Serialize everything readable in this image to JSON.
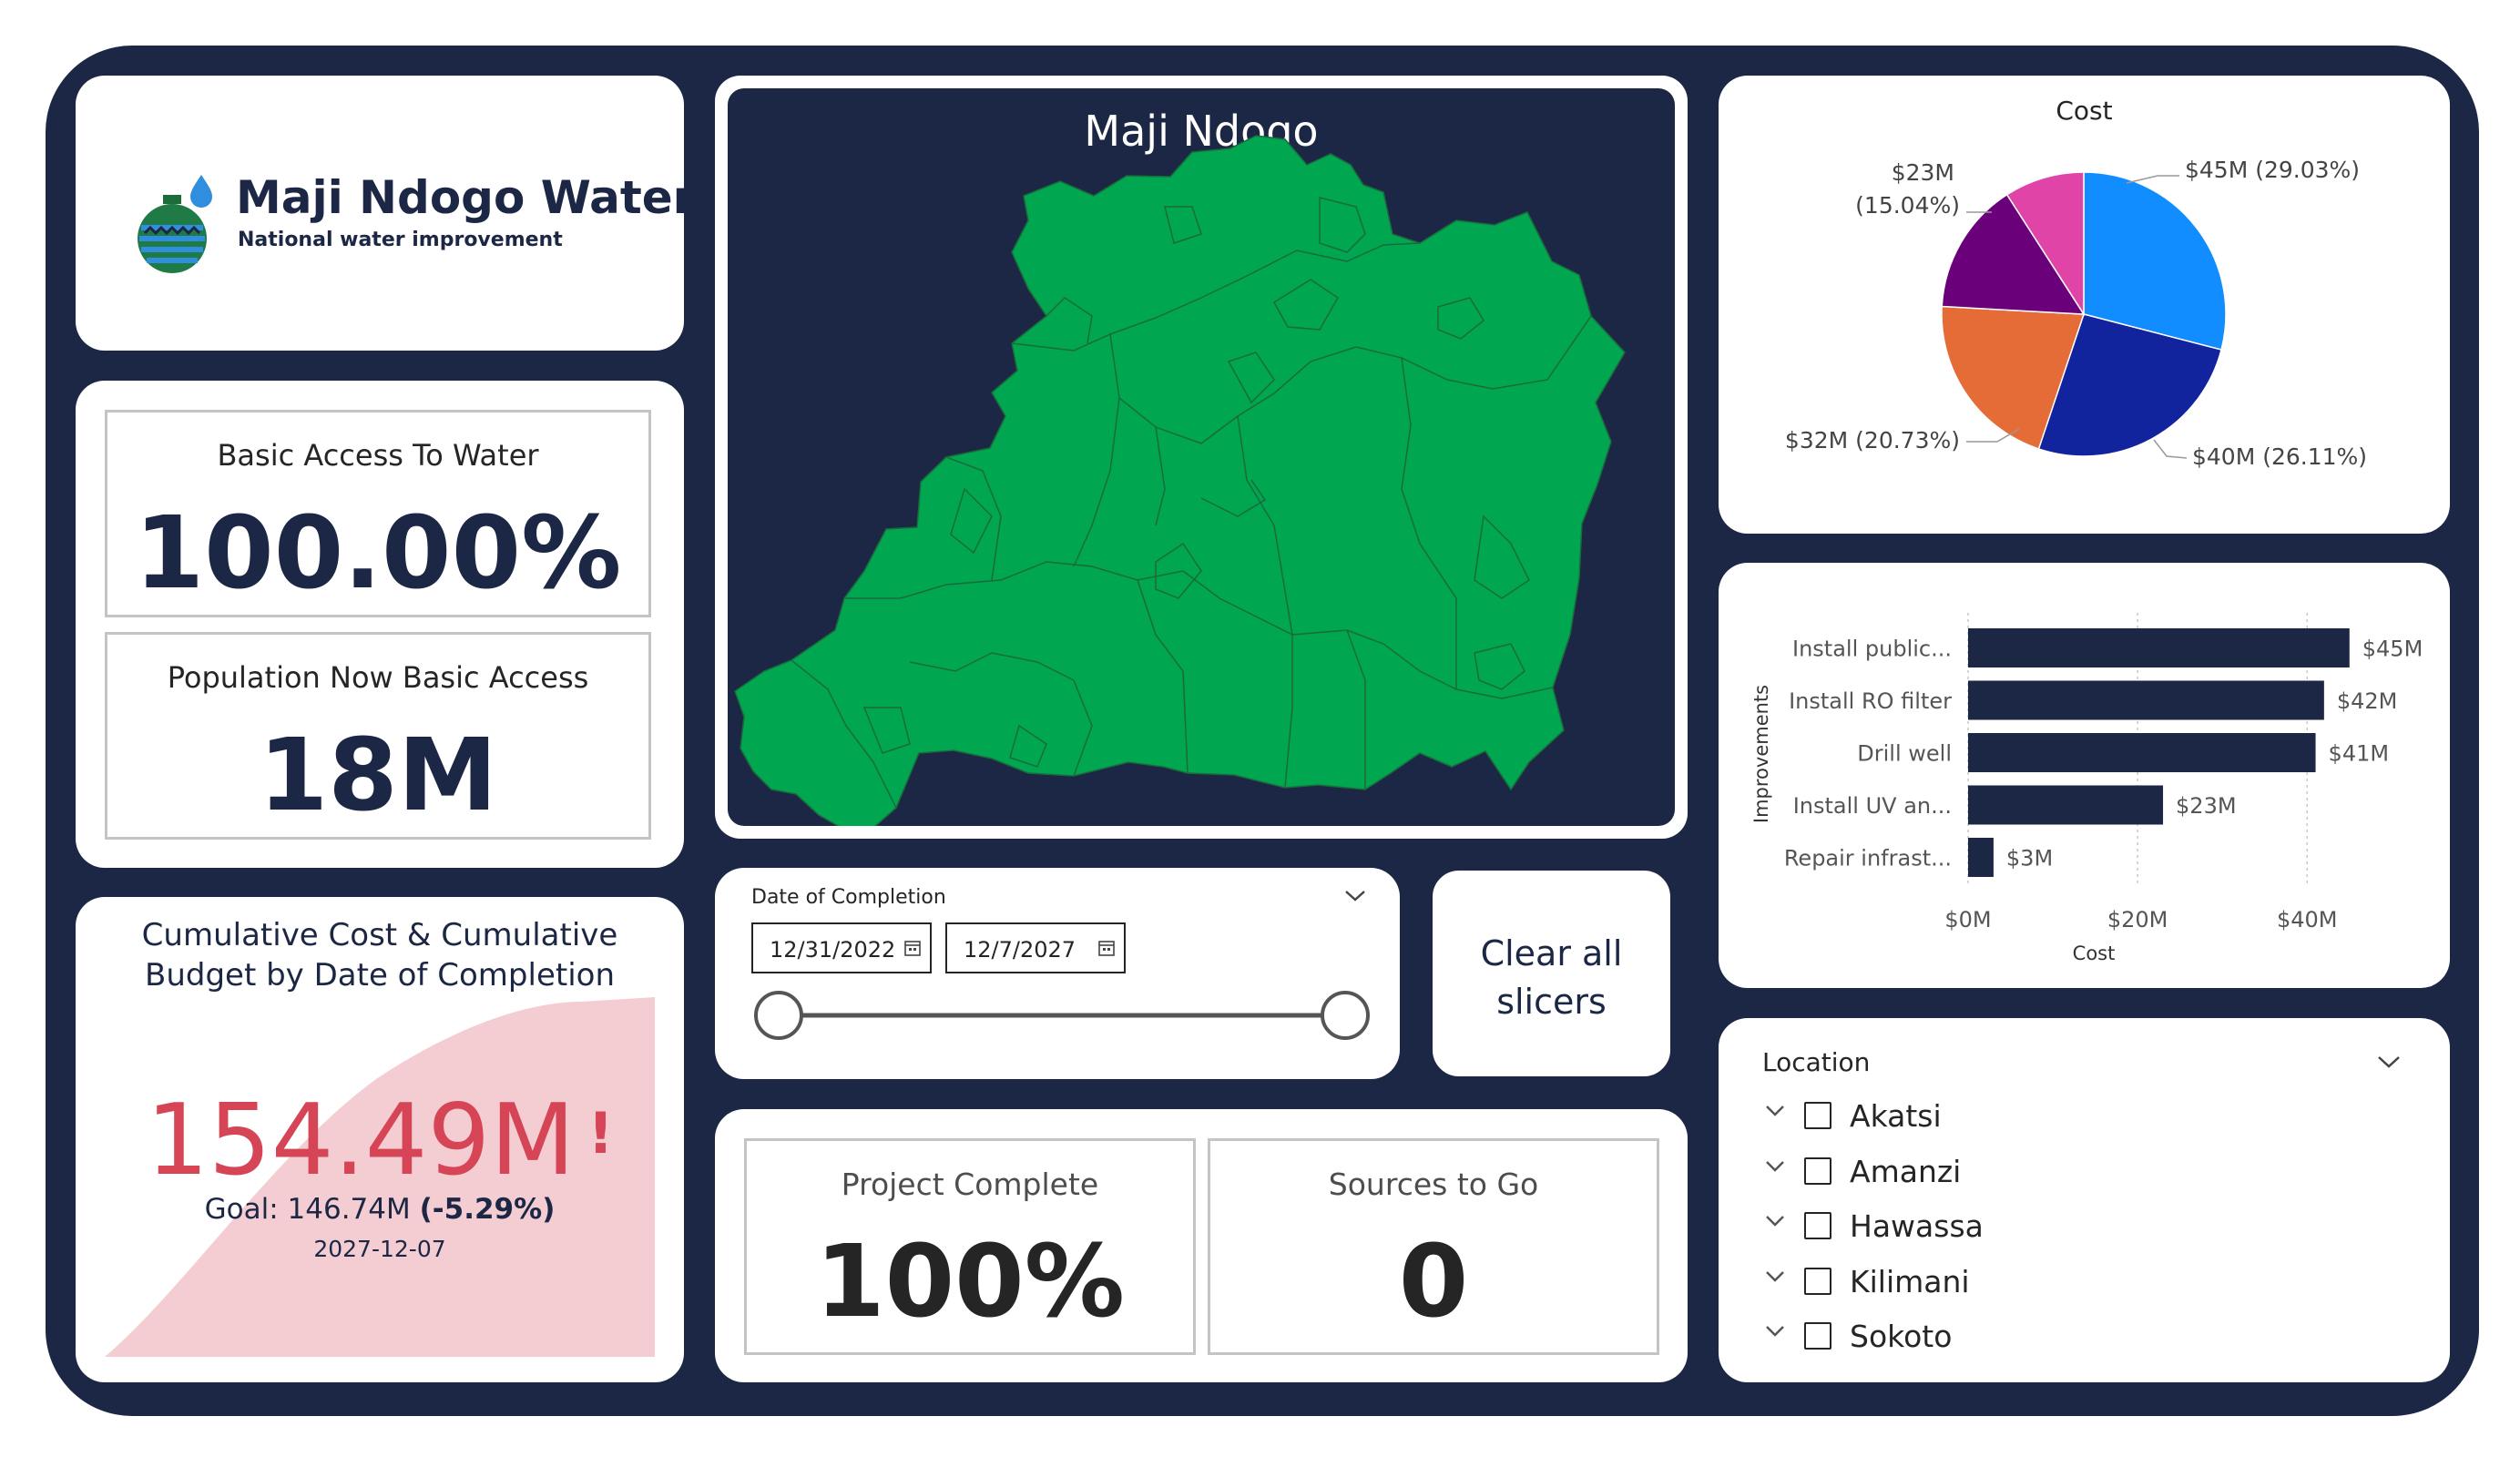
{
  "logo": {
    "title": "Maji Ndogo Water",
    "subtitle": "National water improvement",
    "icon": "water-pot-droplet-icon"
  },
  "kpis": {
    "basic_access_label": "Basic Access To Water",
    "basic_access_value": "100.00%",
    "population_label": "Population Now Basic Access",
    "population_value": "18M"
  },
  "cumulative": {
    "title": "Cumulative Cost & Cumulative Budget by Date of Completion",
    "value": "154.49M",
    "alert": "!",
    "goal_prefix": "Goal: 146.74M ",
    "goal_pct": "(-5.29%)",
    "date": "2027-12-07",
    "area_color": "#f4cdd3",
    "value_color": "#d64555"
  },
  "map": {
    "title": "Maji Ndogo",
    "fill_color": "#00a650"
  },
  "date_slicer": {
    "label": "Date of Completion",
    "start": "12/31/2022",
    "end": "12/7/2027",
    "range_selected": [
      0.0,
      1.0
    ]
  },
  "clear_button": {
    "label_line1": "Clear all",
    "label_line2": "slicers"
  },
  "project": {
    "complete_label": "Project Complete",
    "complete_value": "100%",
    "sources_label": "Sources to Go",
    "sources_value": "0"
  },
  "chart_data": [
    {
      "type": "pie",
      "title": "Cost",
      "slices": [
        {
          "label": "$45M (29.03%)",
          "value": 29.03,
          "color": "#118dff"
        },
        {
          "label": "$40M (26.11%)",
          "value": 26.11,
          "color": "#12239e"
        },
        {
          "label": "$32M (20.73%)",
          "value": 20.73,
          "color": "#e66c37"
        },
        {
          "label": "$23M (15.04%)",
          "value": 15.04,
          "color": "#6b007b"
        },
        {
          "label": "",
          "value": 9.09,
          "color": "#e044a7"
        }
      ]
    },
    {
      "type": "bar",
      "orientation": "horizontal",
      "categories": [
        "Install public...",
        "Install RO filter",
        "Drill well",
        "Install UV an...",
        "Repair infrast..."
      ],
      "values": [
        45,
        42,
        41,
        23,
        3
      ],
      "data_labels": [
        "$45M",
        "$42M",
        "$41M",
        "$23M",
        "$3M"
      ],
      "xlabel": "Cost",
      "ylabel": "Improvements",
      "x_ticks": [
        "$0M",
        "$20M",
        "$40M"
      ],
      "x_tick_values": [
        0,
        20,
        40
      ],
      "xlim": [
        0,
        49
      ],
      "grid": true,
      "bar_color": "#1c2745"
    }
  ],
  "location": {
    "title": "Location",
    "items": [
      "Akatsi",
      "Amanzi",
      "Hawassa",
      "Kilimani",
      "Sokoto"
    ]
  }
}
